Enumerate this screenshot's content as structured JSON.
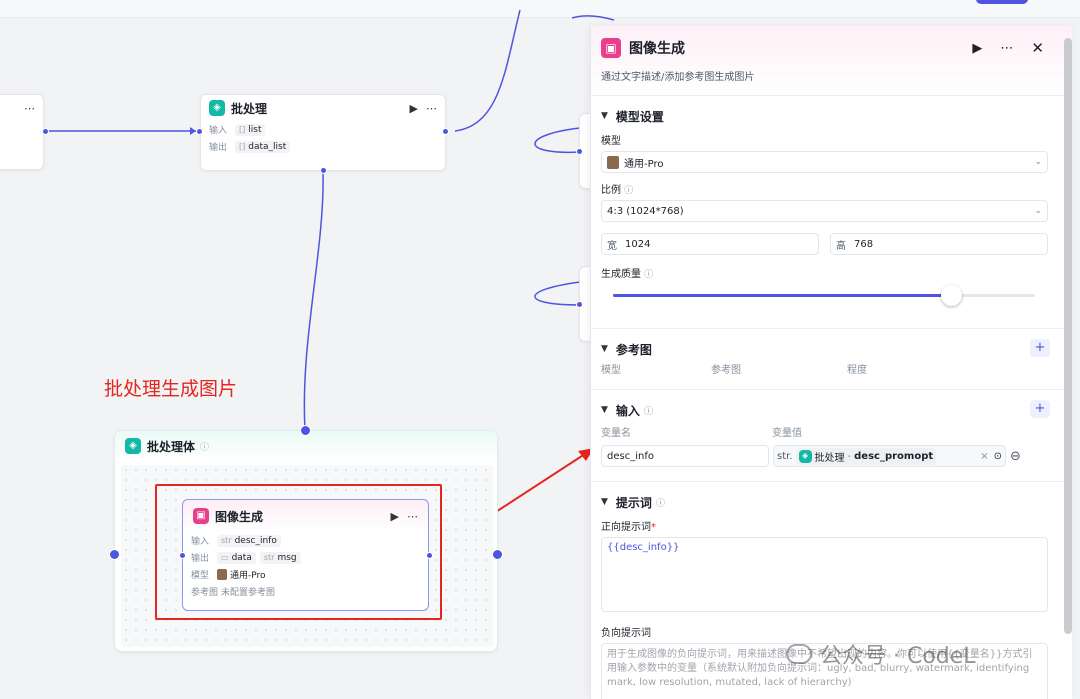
{
  "annotation": "批处理生成图片",
  "batch_node": {
    "title": "批处理",
    "in_label": "输入",
    "out_label": "输出",
    "input_type": "[]",
    "input_var": "list",
    "output_type": "[]",
    "output_var": "data_list"
  },
  "batch_body": {
    "title": "批处理体",
    "info": "ⓘ"
  },
  "inner_node": {
    "title": "图像生成",
    "in_label": "输入",
    "out_label": "输出",
    "model_label": "模型",
    "ref_label": "参考图",
    "input_type": "str",
    "input_var": "desc_info",
    "output1_var": "data",
    "output2_type": "str",
    "output2_var": "msg",
    "model_value": "通用-Pro",
    "ref_value": "未配置参考图"
  },
  "panel": {
    "title": "图像生成",
    "subtitle": "通过文字描述/添加参考图生成图片",
    "model_section": {
      "title": "模型设置",
      "model_label": "模型",
      "model_value": "通用-Pro",
      "ratio_label": "比例",
      "ratio_value": "4:3 (1024*768)",
      "width_label": "宽",
      "width_value": "1024",
      "height_label": "高",
      "height_value": "768",
      "quality_label": "生成质量",
      "quality_level": 0.8
    },
    "ref_section": {
      "title": "参考图",
      "col1": "模型",
      "col2": "参考图",
      "col3": "程度"
    },
    "input_section": {
      "title": "输入",
      "col_name": "变量名",
      "col_value": "变量值",
      "var_name": "desc_info",
      "var_type": "str.",
      "var_source": "批处理",
      "var_sep": "-",
      "var_value": "desc_promopt"
    },
    "prompt_section": {
      "title": "提示词",
      "positive_label": "正向提示词",
      "required_mark": "*",
      "positive_value": "{{desc_info}}",
      "negative_label": "负向提示词",
      "negative_placeholder": "用于生成图像的负向提示词，用来描述图像中不希望出现的内容。你可以使用{{变量名}}方式引用输入参数中的变量（系统默认附加负向提示词：ugly, bad, blurry, watermark, identifying mark, low resolution, mutated, lack of hierarchy)"
    }
  },
  "watermark": {
    "text": "公众号 · CodeL"
  },
  "colors": {
    "accent": "#4e55e0",
    "teal": "#14b8a6",
    "pink": "#e83e8c",
    "annotation_red": "#e5261f"
  }
}
